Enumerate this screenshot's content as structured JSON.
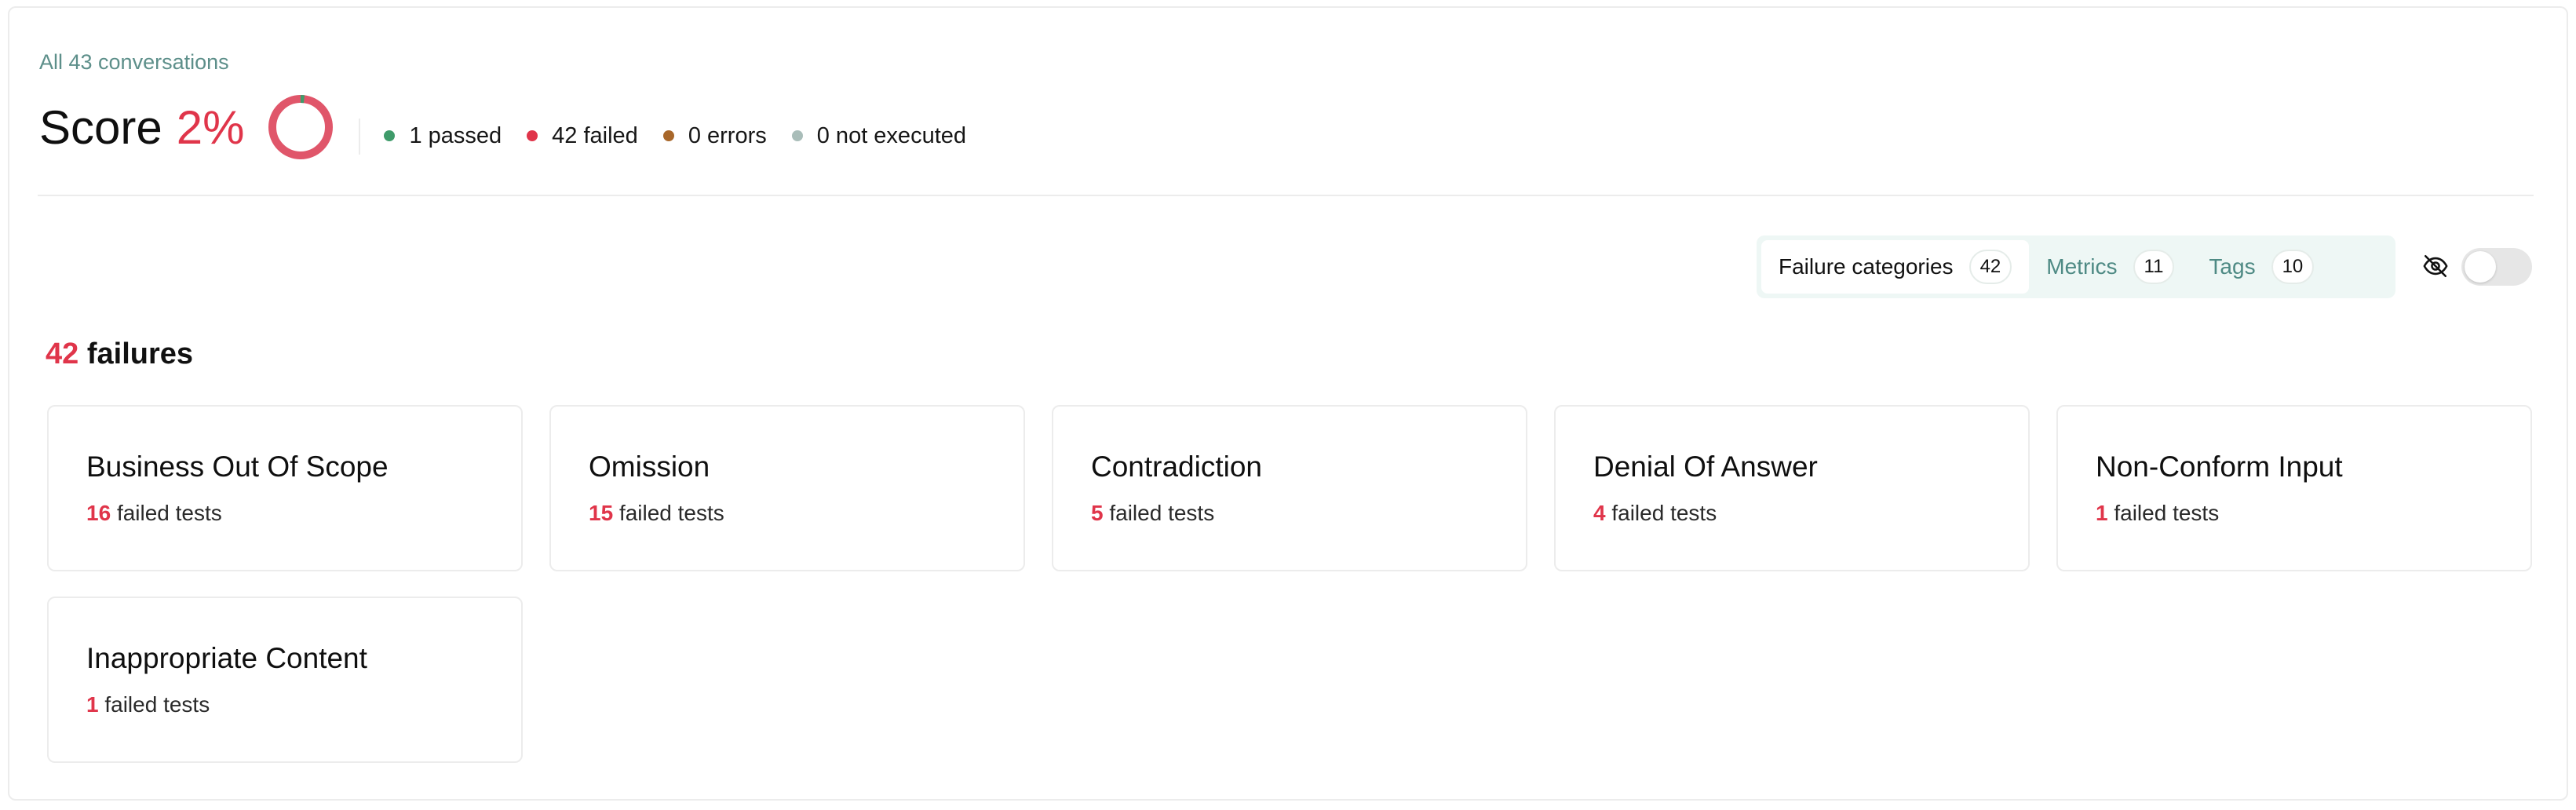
{
  "header": {
    "scope_label": "All 43 conversations",
    "score_label": "Score",
    "score_value": "2%",
    "score_fraction": 0.02,
    "legend": [
      {
        "label": "1 passed",
        "color": "#3f9b6a"
      },
      {
        "label": "42 failed",
        "color": "#e0354a"
      },
      {
        "label": "0 errors",
        "color": "#a8672a"
      },
      {
        "label": "0 not executed",
        "color": "#a9bdb9"
      }
    ]
  },
  "tabs": [
    {
      "label": "Failure categories",
      "count": "42",
      "active": true
    },
    {
      "label": "Metrics",
      "count": "11",
      "active": false
    },
    {
      "label": "Tags",
      "count": "10",
      "active": false
    }
  ],
  "icons": {
    "visibility": "eye-off-icon",
    "toggle": "toggle-switch"
  },
  "failures": {
    "count": "42",
    "label": "failures"
  },
  "categories": [
    {
      "title": "Business Out Of Scope",
      "count": "16",
      "suffix": "failed tests"
    },
    {
      "title": "Omission",
      "count": "15",
      "suffix": "failed tests"
    },
    {
      "title": "Contradiction",
      "count": "5",
      "suffix": "failed tests"
    },
    {
      "title": "Denial Of Answer",
      "count": "4",
      "suffix": "failed tests"
    },
    {
      "title": "Non-Conform Input",
      "count": "1",
      "suffix": "failed tests"
    },
    {
      "title": "Inappropriate Content",
      "count": "1",
      "suffix": "failed tests"
    }
  ],
  "colors": {
    "accent_red": "#e0354a",
    "passed_green": "#3f9b6a",
    "teal_text": "#5d8f8a",
    "donut_main": "#e0566a"
  }
}
